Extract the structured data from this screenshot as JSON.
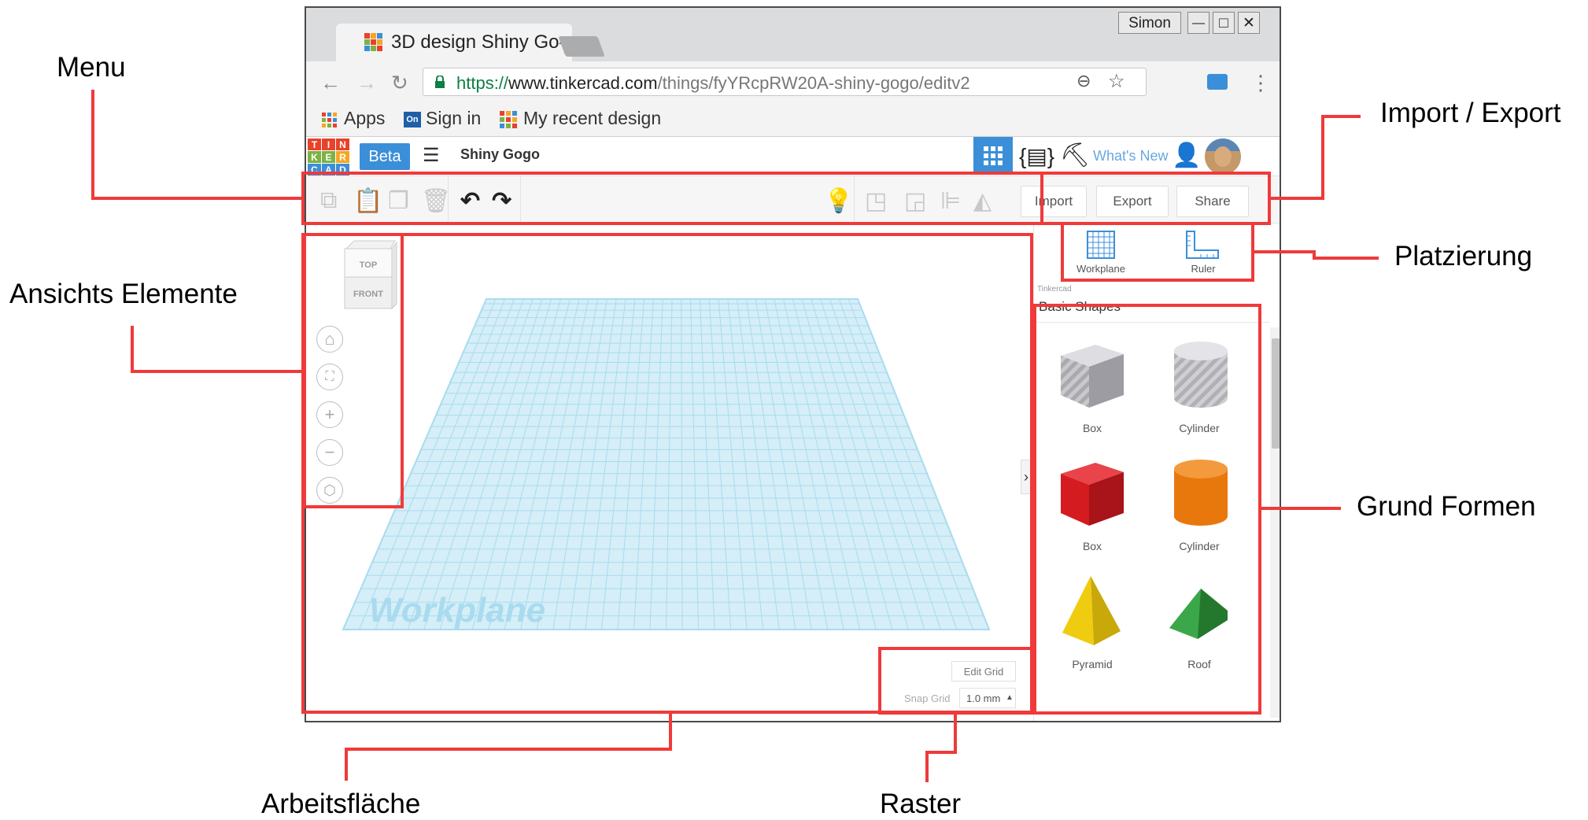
{
  "annotations": {
    "menu": "Menu",
    "import_export": "Import / Export",
    "platzierung": "Platzierung",
    "ansichts": "Ansichts Elemente",
    "grund_formen": "Grund Formen",
    "arbeitsflaeche": "Arbeitsfläche",
    "raster": "Raster"
  },
  "browser": {
    "tab_title": "3D design Shiny Go",
    "tab_close": "×",
    "user": "Simon",
    "url_scheme": "https://",
    "url_host": "www.tinkercad.com",
    "url_path": "/things/fyYRcpRW20A-shiny-gogo/editv2",
    "bookmarks": [
      "Apps",
      "Sign in",
      "My recent design"
    ]
  },
  "header": {
    "logo": [
      "T",
      "I",
      "N",
      "K",
      "E",
      "R",
      "C",
      "A",
      "D"
    ],
    "beta": "Beta",
    "design_name": "Shiny Gogo",
    "whats_new": "What's New"
  },
  "toolbar": {
    "import": "Import",
    "export": "Export",
    "share": "Share"
  },
  "placement": {
    "workplane": "Workplane",
    "ruler": "Ruler"
  },
  "library": {
    "source": "Tinkercad",
    "category": "Basic Shapes",
    "shapes": [
      {
        "label": "Box",
        "color": "#b8b8bc"
      },
      {
        "label": "Cylinder",
        "color": "#c0c0c4"
      },
      {
        "label": "Box",
        "color": "#d41c20"
      },
      {
        "label": "Cylinder",
        "color": "#e8780c"
      },
      {
        "label": "Pyramid",
        "color": "#f0cc10"
      },
      {
        "label": "Roof",
        "color": "#2e9a3a"
      }
    ]
  },
  "viewcube": {
    "top": "TOP",
    "front": "FRONT"
  },
  "workplane_label": "Workplane",
  "grid": {
    "edit_grid": "Edit Grid",
    "snap_label": "Snap Grid",
    "snap_value": "1.0 mm"
  },
  "colors": {
    "annotation_red": "#f03a3a",
    "tinkercad_blue": "#3b8fd8",
    "workplane_blue": "#a9dbee"
  }
}
